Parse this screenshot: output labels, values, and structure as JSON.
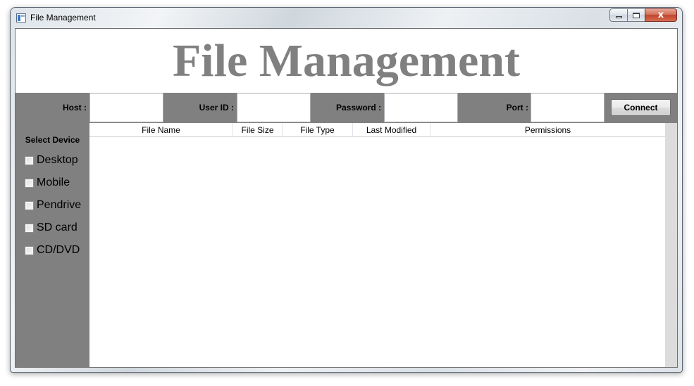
{
  "window": {
    "title": "File Management",
    "controls": {
      "minimize": "minimize",
      "maximize": "maximize",
      "close": "x"
    }
  },
  "heading": "File Management",
  "connection": {
    "host_label": "Host :",
    "user_label": "User ID :",
    "password_label": "Password :",
    "port_label": "Port :",
    "host_value": "",
    "user_value": "",
    "password_value": "",
    "port_value": "",
    "connect_label": "Connect"
  },
  "sidebar": {
    "title": "Select Device",
    "devices": [
      {
        "label": "Desktop",
        "checked": false
      },
      {
        "label": "Mobile",
        "checked": false
      },
      {
        "label": "Pendrive",
        "checked": false
      },
      {
        "label": "SD card",
        "checked": false
      },
      {
        "label": "CD/DVD",
        "checked": false
      }
    ]
  },
  "table": {
    "columns": [
      "File Name",
      "File Size",
      "File Type",
      "Last Modified",
      "Permissions"
    ],
    "rows": []
  },
  "colors": {
    "panel": "#808080",
    "heading_text": "#808080",
    "background": "#ffffff"
  }
}
